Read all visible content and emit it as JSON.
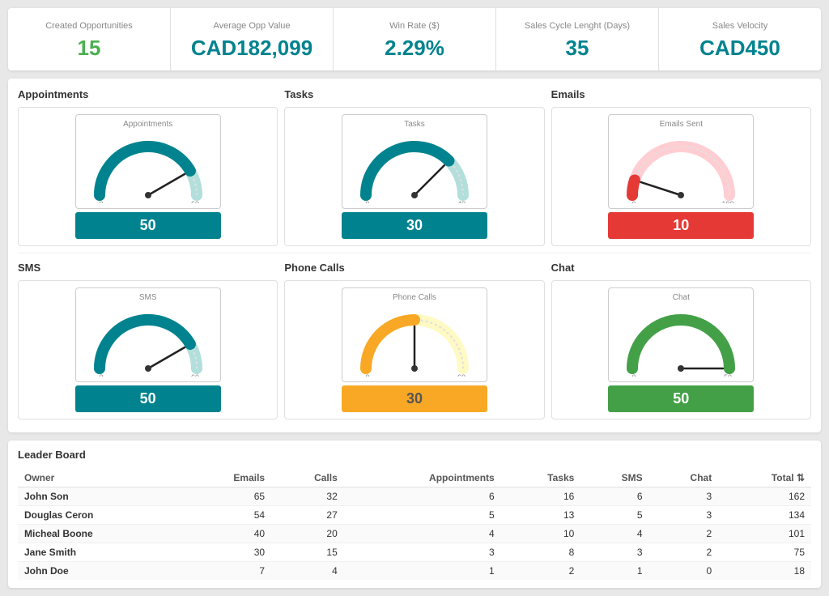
{
  "kpis": [
    {
      "id": "created-opp",
      "label": "Created Opportunities",
      "value": "15",
      "color": "green"
    },
    {
      "id": "avg-opp-value",
      "label": "Average Opp Value",
      "value": "CAD182,099",
      "color": "teal"
    },
    {
      "id": "win-rate",
      "label": "Win Rate ($)",
      "value": "2.29%",
      "color": "teal"
    },
    {
      "id": "sales-cycle",
      "label": "Sales Cycle Lenght (Days)",
      "value": "35",
      "color": "teal"
    },
    {
      "id": "sales-velocity",
      "label": "Sales Velocity",
      "value": "CAD450",
      "color": "teal"
    }
  ],
  "gaugeRow1": {
    "title1": "Appointments",
    "title2": "Tasks",
    "title3": "Emails",
    "gauges": [
      {
        "id": "appointments-gauge",
        "label": "Appointments",
        "value": 50,
        "max": 60,
        "min": 0,
        "displayValue": "50",
        "colorClass": "teal",
        "trackColor": "#00838f",
        "bgColor": "#b2dfdb"
      },
      {
        "id": "tasks-gauge",
        "label": "Tasks",
        "value": 30,
        "max": 40,
        "min": 0,
        "displayValue": "30",
        "colorClass": "teal",
        "trackColor": "#00838f",
        "bgColor": "#b2dfdb"
      },
      {
        "id": "emails-gauge",
        "label": "Emails Sent",
        "value": 10,
        "max": 100,
        "min": 0,
        "displayValue": "10",
        "colorClass": "red",
        "trackColor": "#e53935",
        "bgColor": "#ffcdd2"
      }
    ]
  },
  "gaugeRow2": {
    "title1": "SMS",
    "title2": "Phone Calls",
    "title3": "Chat",
    "gauges": [
      {
        "id": "sms-gauge",
        "label": "SMS",
        "value": 50,
        "max": 60,
        "min": 0,
        "displayValue": "50",
        "colorClass": "teal",
        "trackColor": "#00838f",
        "bgColor": "#b2dfdb"
      },
      {
        "id": "phonecalls-gauge",
        "label": "Phone Calls",
        "value": 30,
        "max": 60,
        "min": 0,
        "displayValue": "30",
        "colorClass": "yellow",
        "trackColor": "#f9a825",
        "bgColor": "#fff9c4"
      },
      {
        "id": "chat-gauge",
        "label": "Chat",
        "value": 50,
        "max": 50,
        "min": 0,
        "displayValue": "50",
        "colorClass": "green",
        "trackColor": "#43a047",
        "bgColor": "#c8e6c9"
      }
    ]
  },
  "leaderboard": {
    "title": "Leader Board",
    "columns": [
      "Owner",
      "Emails",
      "Calls",
      "Appointments",
      "Tasks",
      "SMS",
      "Chat",
      "Total"
    ],
    "rows": [
      {
        "owner": "John Son",
        "emails": 65,
        "calls": 32,
        "appointments": 6,
        "tasks": 16,
        "sms": 6,
        "chat": 3,
        "total": 162
      },
      {
        "owner": "Douglas Ceron",
        "emails": 54,
        "calls": 27,
        "appointments": 5,
        "tasks": 13,
        "sms": 5,
        "chat": 3,
        "total": 134
      },
      {
        "owner": "Micheal Boone",
        "emails": 40,
        "calls": 20,
        "appointments": 4,
        "tasks": 10,
        "sms": 4,
        "chat": 2,
        "total": 101
      },
      {
        "owner": "Jane Smith",
        "emails": 30,
        "calls": 15,
        "appointments": 3,
        "tasks": 8,
        "sms": 3,
        "chat": 2,
        "total": 75
      },
      {
        "owner": "John Doe",
        "emails": 7,
        "calls": 4,
        "appointments": 1,
        "tasks": 2,
        "sms": 1,
        "chat": 0,
        "total": 18
      }
    ]
  }
}
